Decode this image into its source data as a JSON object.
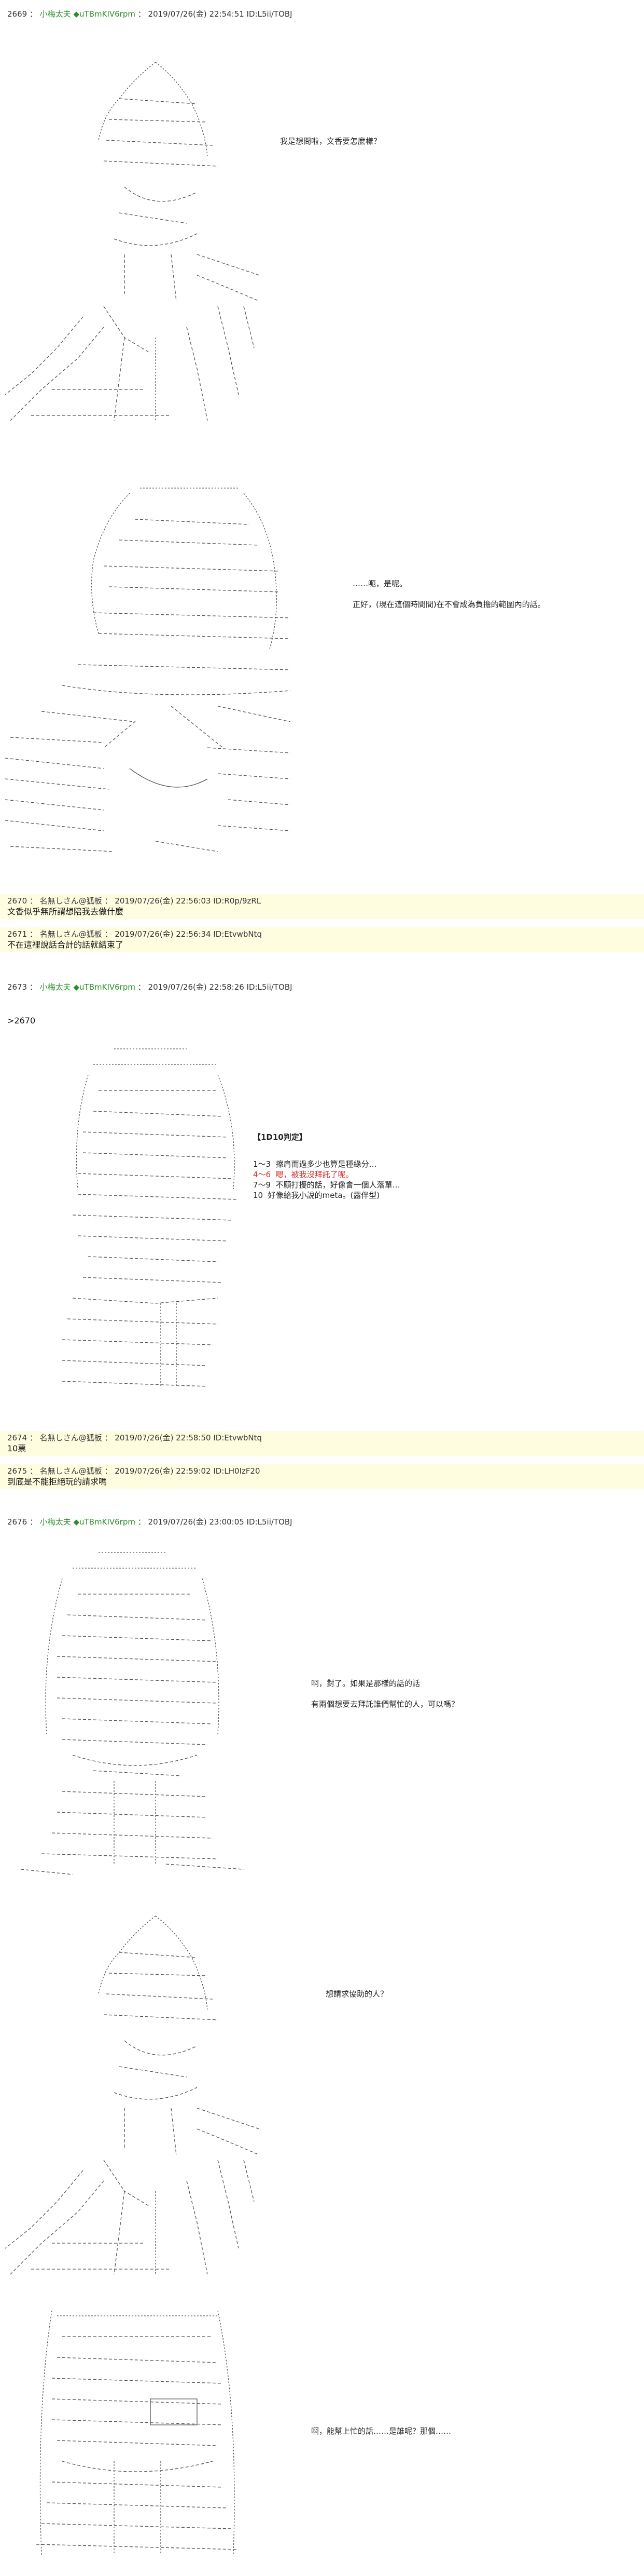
{
  "posts": [
    {
      "num": "2669",
      "name": "小梅太夫 ◆uTBmKIV6rpm",
      "date": "2019/07/26(金) 22:54:51",
      "id": "ID:L5ii/TOBJ"
    },
    {
      "num": "2670",
      "name": "名無しさん@狐板",
      "date": "2019/07/26(金) 22:56:03",
      "id": "ID:R0p/9zRL",
      "body": "文香似乎無所謂想陪我去做什麼"
    },
    {
      "num": "2671",
      "name": "名無しさん@狐板",
      "date": "2019/07/26(金) 22:56:34",
      "id": "ID:EtvwbNtq",
      "body": "不在這裡說話合計的話就結束了"
    },
    {
      "num": "2673",
      "name": "小梅太夫 ◆uTBmKIV6rpm",
      "date": "2019/07/26(金) 22:58:26",
      "id": "ID:L5ii/TOBJ"
    },
    {
      "num": "2674",
      "name": "名無しさん@狐板",
      "date": "2019/07/26(金) 22:58:50",
      "id": "ID:EtvwbNtq",
      "body": "10票"
    },
    {
      "num": "2675",
      "name": "名無しさん@狐板",
      "date": "2019/07/26(金) 22:59:02",
      "id": "ID:LH0IzF20",
      "body": "到底是不能拒絕玩的請求嗎"
    },
    {
      "num": "2676",
      "name": "小梅太夫 ◆uTBmKIV6rpm",
      "date": "2019/07/26(金) 23:00:05",
      "id": "ID:L5ii/TOBJ"
    }
  ],
  "reply_anchor": ">2670",
  "scene1": {
    "line": "我是想問啦，文香要怎麼樣？"
  },
  "scene2": {
    "line1": "……呃，是呢。",
    "line2": "正好，(現在這個時間間)在不會成為負擔的範圍內的話。"
  },
  "scene3": {
    "title": "【1D10判定】",
    "rows": [
      {
        "range": "1～3",
        "text": "擦肩而過多少也算是種緣分…"
      },
      {
        "range": "4～6",
        "text": "嗯，被我沒拜託了呢。"
      },
      {
        "range": "7～9",
        "text": "不願打擾的話，好像會一個人落單…"
      },
      {
        "range": "10",
        "text": "好像給我小說的meta。(露伴型)"
      }
    ]
  },
  "scene4": {
    "line1": "啊，對了。如果是那樣的話的話",
    "line2": "有兩個想要去拜託誰們幫忙的人，可以嗎？"
  },
  "scene5": {
    "line": "想請求協助的人？"
  },
  "scene6": {
    "line": "啊，能幫上忙的話……是誰呢？那個……"
  }
}
